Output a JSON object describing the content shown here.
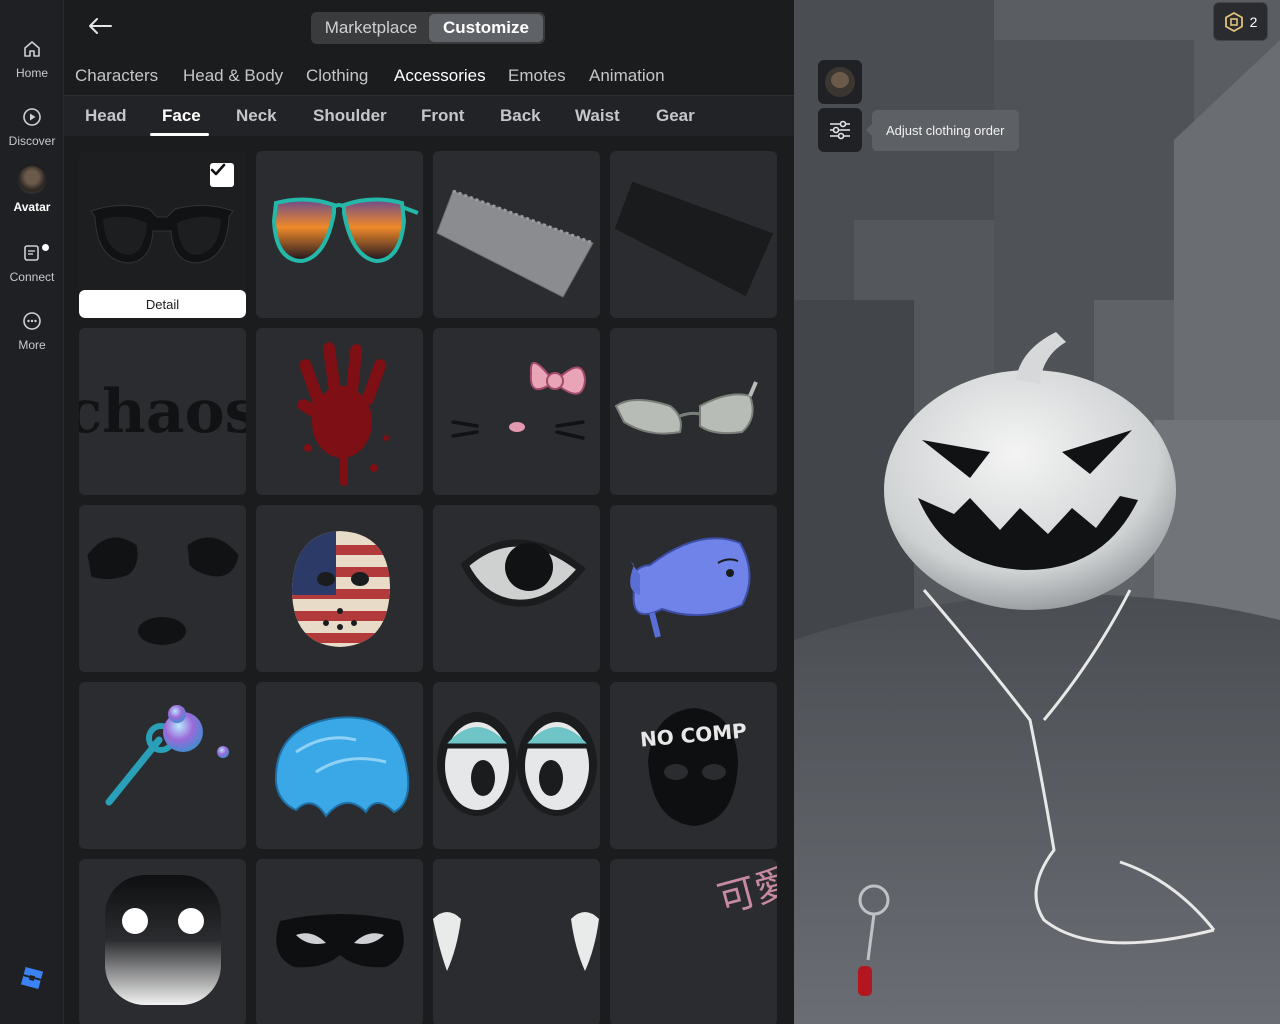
{
  "nav": {
    "items": [
      {
        "label": "Home",
        "icon": "home-icon"
      },
      {
        "label": "Discover",
        "icon": "play-circle-icon"
      },
      {
        "label": "Avatar",
        "icon": "avatar-thumbnail"
      },
      {
        "label": "Connect",
        "icon": "chat-icon"
      },
      {
        "label": "More",
        "icon": "more-dots-icon"
      }
    ],
    "active": "Avatar"
  },
  "mode_toggle": {
    "marketplace": "Marketplace",
    "customize": "Customize",
    "selected": "Customize"
  },
  "categories": [
    "Characters",
    "Head & Body",
    "Clothing",
    "Accessories",
    "Emotes",
    "Animation"
  ],
  "selected_category": "Accessories",
  "subcategories": [
    "Head",
    "Face",
    "Neck",
    "Shoulder",
    "Front",
    "Back",
    "Waist",
    "Gear"
  ],
  "selected_subcategory": "Face",
  "grid": {
    "detail_label": "Detail",
    "tile_1_text": "chaos",
    "tile_15_text": "NO COMP",
    "tile_19_text": "可愛い"
  },
  "tooltip": "Adjust clothing order",
  "robux": {
    "count": "2"
  },
  "colors": {
    "accent": "#ffffff",
    "panel": "#2b2c2f",
    "background": "#1b1c1e"
  }
}
